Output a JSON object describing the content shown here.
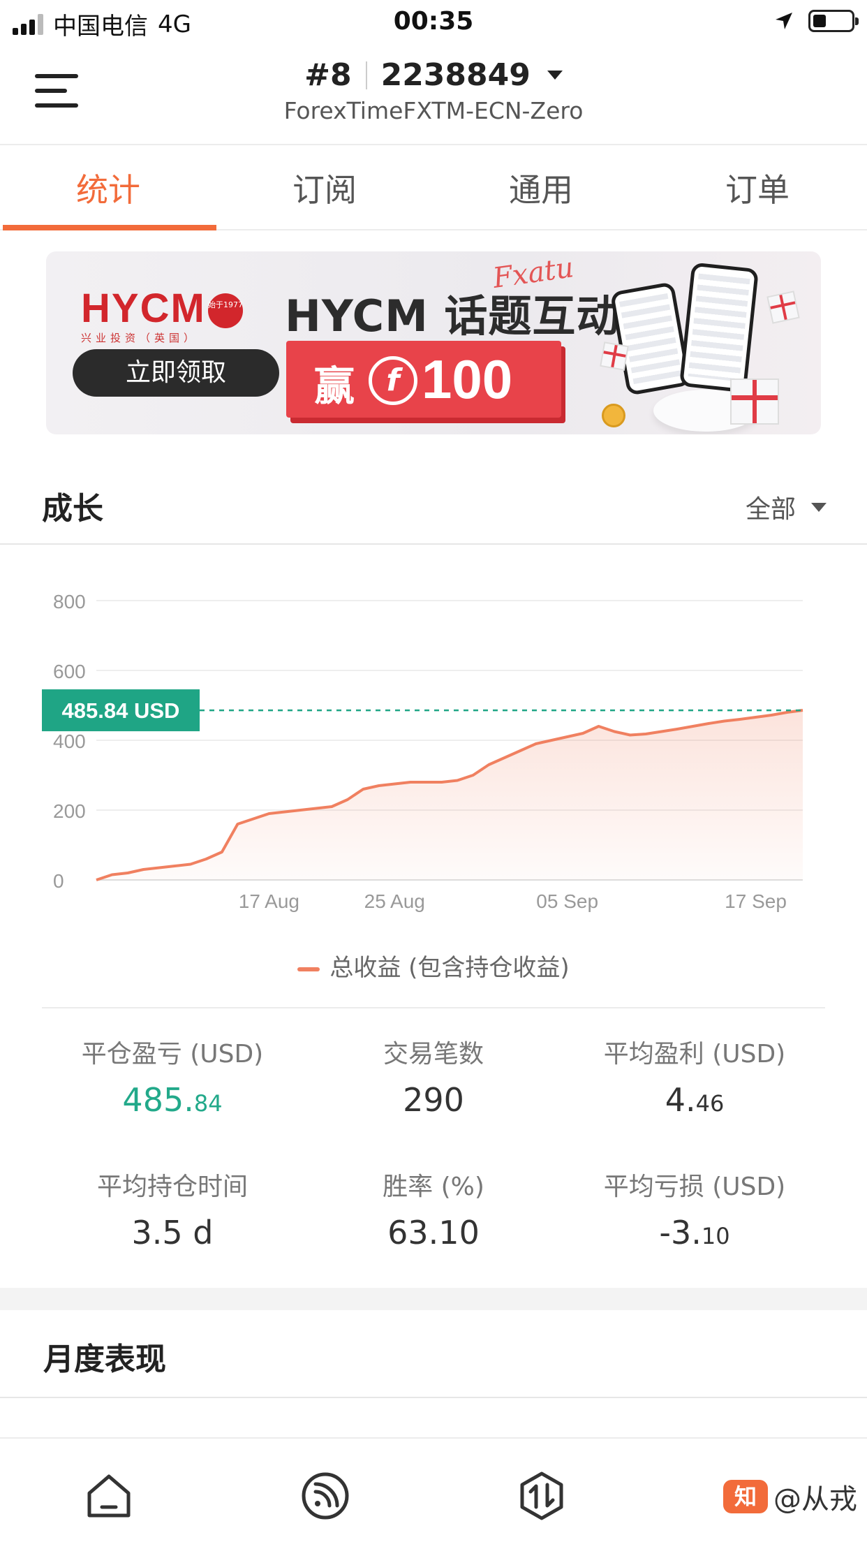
{
  "status_bar": {
    "carrier": "中国电信",
    "network": "4G",
    "time": "00:35"
  },
  "header": {
    "rank": "#8",
    "account_id": "2238849",
    "broker": "ForexTimeFXTM-ECN-Zero"
  },
  "tabs": [
    {
      "label": "统计",
      "active": true
    },
    {
      "label": "订阅",
      "active": false
    },
    {
      "label": "通用",
      "active": false
    },
    {
      "label": "订单",
      "active": false
    }
  ],
  "banner": {
    "logo": "HYCM",
    "logo_sub": "兴业投资（英国）",
    "seal": "始于1977",
    "button": "立即领取",
    "title": "HYCM 话题互动",
    "script": "Fxatu",
    "win_label": "赢",
    "coin_symbol": "f",
    "amount": "100"
  },
  "growth": {
    "title": "成长",
    "range": "全部"
  },
  "chart_data": {
    "type": "area",
    "series": [
      {
        "name": "总收益 (包含持仓收益)",
        "color": "#f08060",
        "x": [
          "08-06",
          "08-07",
          "08-08",
          "08-09",
          "08-10",
          "08-11",
          "08-12",
          "08-13",
          "08-14",
          "08-15",
          "08-16",
          "08-17",
          "08-18",
          "08-19",
          "08-20",
          "08-21",
          "08-22",
          "08-23",
          "08-24",
          "08-25",
          "08-26",
          "08-27",
          "08-28",
          "08-29",
          "08-30",
          "08-31",
          "09-01",
          "09-02",
          "09-03",
          "09-04",
          "09-05",
          "09-06",
          "09-07",
          "09-08",
          "09-09",
          "09-10",
          "09-11",
          "09-12",
          "09-13",
          "09-14",
          "09-15",
          "09-16",
          "09-17",
          "09-18",
          "09-19",
          "09-20"
        ],
        "values": [
          0,
          15,
          20,
          30,
          35,
          40,
          45,
          60,
          80,
          160,
          175,
          190,
          195,
          200,
          205,
          210,
          230,
          260,
          270,
          275,
          280,
          280,
          280,
          285,
          300,
          330,
          350,
          370,
          390,
          400,
          410,
          420,
          440,
          425,
          415,
          418,
          425,
          432,
          440,
          448,
          455,
          460,
          466,
          472,
          480,
          486
        ]
      }
    ],
    "x_ticks": [
      "17 Aug",
      "25 Aug",
      "05 Sep",
      "17 Sep"
    ],
    "y_ticks": [
      0,
      200,
      400,
      600,
      800
    ],
    "ylim": [
      0,
      800
    ],
    "current_value_label": "485.84 USD",
    "current_value": 485.84,
    "grid": true,
    "legend": "bottom"
  },
  "stats": [
    {
      "label": "平仓盈亏 (USD)",
      "int": "485.",
      "dec": "84",
      "style": "green"
    },
    {
      "label": "交易笔数",
      "int": "290",
      "dec": "",
      "style": "normal"
    },
    {
      "label": "平均盈利 (USD)",
      "int": "4.",
      "dec": "46",
      "style": "normal"
    },
    {
      "label": "平均持仓时间",
      "int": "3.5 d",
      "dec": "",
      "style": "normal"
    },
    {
      "label": "胜率 (%)",
      "int": "63.10",
      "dec": "",
      "style": "normal"
    },
    {
      "label": "平均亏损 (USD)",
      "int": "-3.",
      "dec": "10",
      "style": "normal"
    }
  ],
  "monthly": {
    "title": "月度表现"
  },
  "bottom_nav": {
    "items": [
      {
        "icon": "home-icon"
      },
      {
        "icon": "signal-feed-icon"
      },
      {
        "icon": "trade-arrows-icon"
      }
    ],
    "watermark": "@从戎",
    "watermark_badge": "知"
  },
  "colors": {
    "accent": "#f26b3a",
    "positive": "#22a98a",
    "chart_line": "#f08060",
    "current_value_bg": "#1fa585"
  }
}
